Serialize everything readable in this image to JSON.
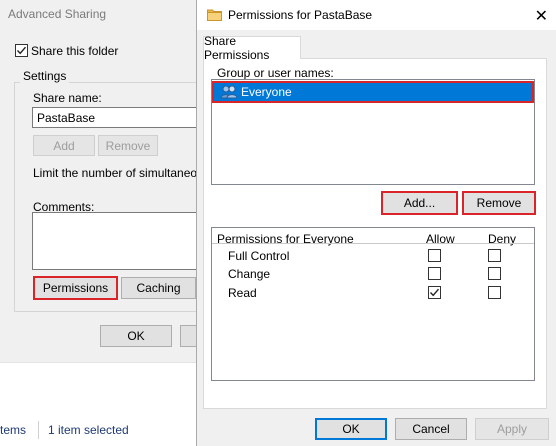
{
  "advanced_sharing": {
    "title": "Advanced Sharing",
    "share_this_folder_label": "Share this folder",
    "share_this_folder_checked": true,
    "settings_group_label": "Settings",
    "share_name_label": "Share name:",
    "share_name_value": "PastaBase",
    "add_label": "Add",
    "remove_label": "Remove",
    "limit_label": "Limit the number of simultaneous u",
    "comments_label": "Comments:",
    "permissions_label": "Permissions",
    "caching_label": "Caching",
    "ok_label": "OK"
  },
  "status_bar": {
    "items_label": "tems",
    "selected_label": "1 item selected"
  },
  "permissions_dialog": {
    "title": "Permissions for PastaBase",
    "close_glyph": "✕",
    "tab_label": "Share Permissions",
    "group_label": "Group or user names:",
    "users": [
      {
        "name": "Everyone",
        "selected": true
      }
    ],
    "add_label": "Add...",
    "remove_label": "Remove",
    "permissions_for_label": "Permissions for Everyone",
    "allow_header": "Allow",
    "deny_header": "Deny",
    "permissions": [
      {
        "name": "Full Control",
        "allow": false,
        "deny": false
      },
      {
        "name": "Change",
        "allow": false,
        "deny": false
      },
      {
        "name": "Read",
        "allow": true,
        "deny": false
      }
    ],
    "ok_label": "OK",
    "cancel_label": "Cancel",
    "apply_label": "Apply"
  },
  "colors": {
    "selection": "#0078d7",
    "highlight_outline": "#d9242a",
    "dialog_bg": "#f0f0f0"
  },
  "icons": [
    "check-icon",
    "folder-icon",
    "users-icon",
    "close-icon"
  ]
}
